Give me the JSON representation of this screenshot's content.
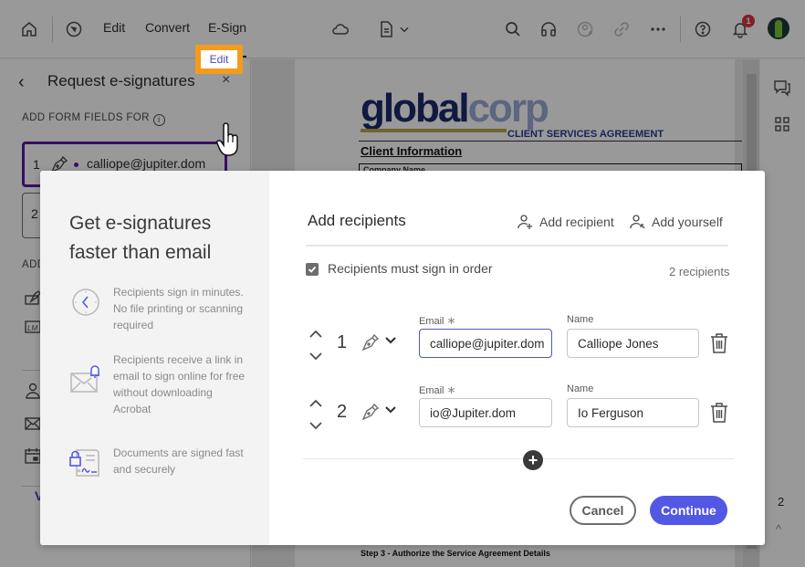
{
  "topbar": {
    "tabs": [
      {
        "label": "Edit",
        "active": false
      },
      {
        "label": "Convert",
        "active": false
      },
      {
        "label": "E-Sign",
        "active": true
      }
    ],
    "icons": [
      "home-icon",
      "compass-icon",
      "cloud-icon",
      "document-icon",
      "search-icon",
      "headphones-icon",
      "share-user-icon",
      "link-icon",
      "more-icon",
      "help-icon",
      "bell-icon",
      "avatar"
    ],
    "notification_count": "1"
  },
  "sidepanel": {
    "title": "Request e-signatures",
    "back_glyph": "‹",
    "close_glyph": "×",
    "form_fields_label": "ADD FORM FIELDS FOR",
    "info_glyph": "i",
    "edit_label": "Edit",
    "recipients": [
      {
        "number": "1",
        "email": "calliope@jupiter.dom",
        "active": true
      },
      {
        "number": "2",
        "email": "",
        "active": false
      }
    ],
    "add_label": "ADD",
    "link_partial": "V"
  },
  "document": {
    "logo_part1": "global",
    "logo_part2": "corp",
    "heading": "CLIENT SERVICES AGREEMENT",
    "section_title": "Client Information",
    "table_first_cell": "Company Name",
    "step_text": "Step 3 - Authorize the Service Agreement Details"
  },
  "rightrail": {
    "page_number": "2",
    "up_glyph": "^"
  },
  "modal": {
    "promo": {
      "title": "Get e-signatures faster than email",
      "features": [
        {
          "icon": "clock-icon",
          "text": "Recipients sign in minutes. No file printing or scanning required"
        },
        {
          "icon": "email-bell-icon",
          "text": "Recipients receive a link in email to sign online for free without downloading Acrobat"
        },
        {
          "icon": "secure-document-icon",
          "text": "Documents are signed fast and securely"
        }
      ]
    },
    "title": "Add recipients",
    "add_recipient_label": "Add recipient",
    "add_yourself_label": "Add yourself",
    "sign_in_order_label": "Recipients must sign in order",
    "sign_in_order_checked": true,
    "recipient_count": "2 recipients",
    "email_label": "Email",
    "required_mark": "∗",
    "name_label": "Name",
    "recipients": [
      {
        "order": "1",
        "email": "calliope@jupiter.dom",
        "name": "Calliope Jones",
        "role_icon": "signer-pen-icon"
      },
      {
        "order": "2",
        "email": "io@Jupiter.dom",
        "name": "Io Ferguson",
        "role_icon": "signer-pen-icon"
      }
    ],
    "add_glyph": "+",
    "cancel_label": "Cancel",
    "continue_label": "Continue"
  },
  "colors": {
    "accent": "#5258e4",
    "active_recipient": "#5a1aa5",
    "highlight": "#f49b1c",
    "badge": "#d7373f"
  }
}
